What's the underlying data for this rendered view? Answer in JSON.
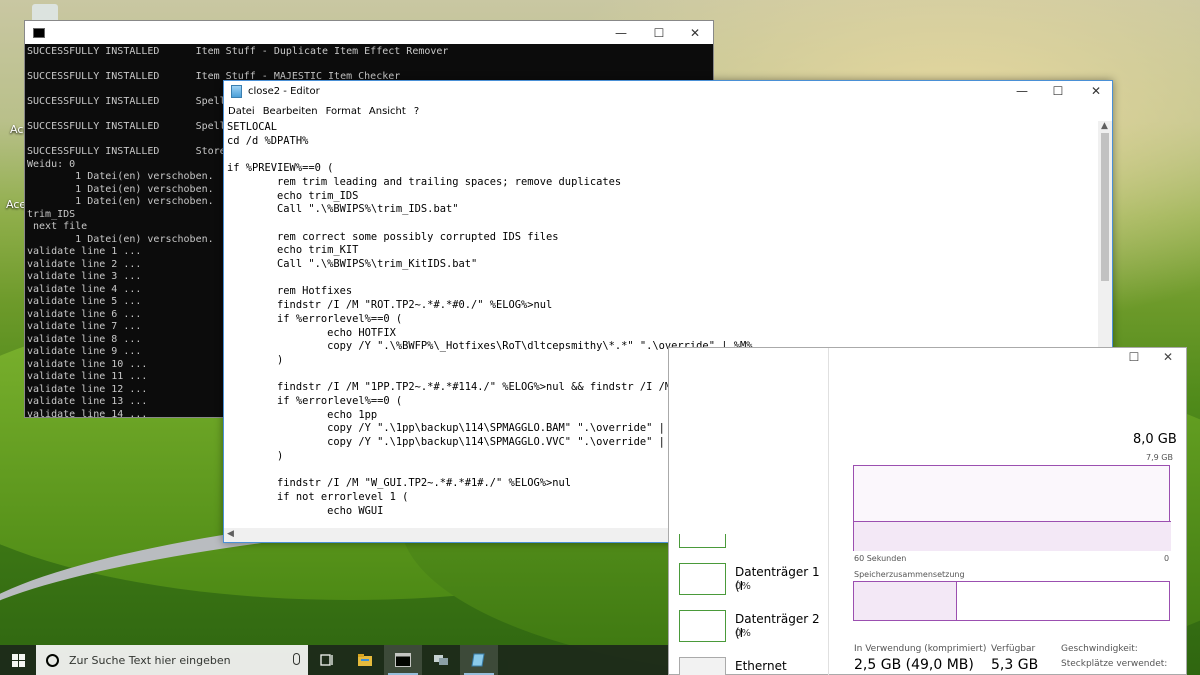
{
  "desktop": {
    "labels": [
      "Ace",
      "Ace"
    ]
  },
  "cmd": {
    "lines": [
      "SUCCESSFULLY INSTALLED      Item Stuff - Duplicate Item Effect Remover",
      "",
      "SUCCESSFULLY INSTALLED      Item Stuff - MAJESTIC Item Checker",
      "",
      "SUCCESSFULLY INSTALLED      Spell S",
      "",
      "SUCCESSFULLY INSTALLED      Spell S",
      "",
      "SUCCESSFULLY INSTALLED      Store S",
      "Weidu: 0",
      "        1 Datei(en) verschoben.",
      "        1 Datei(en) verschoben.",
      "        1 Datei(en) verschoben.",
      "trim_IDS",
      " next file",
      "        1 Datei(en) verschoben.",
      "validate line 1 ...",
      "validate line 2 ...",
      "validate line 3 ...",
      "validate line 4 ...",
      "validate line 5 ...",
      "validate line 6 ...",
      "validate line 7 ...",
      "validate line 8 ...",
      "validate line 9 ...",
      "validate line 10 ...",
      "validate line 11 ...",
      "validate line 12 ...",
      "validate line 13 ...",
      "validate line 14 ..."
    ],
    "buttons": {
      "minimize": "—",
      "maximize": "☐",
      "close": "✕"
    }
  },
  "notepad": {
    "title": "close2 - Editor",
    "menu": [
      "Datei",
      "Bearbeiten",
      "Format",
      "Ansicht",
      "?"
    ],
    "buttons": {
      "minimize": "—",
      "maximize": "☐",
      "close": "✕"
    },
    "content": "SETLOCAL\ncd /d %DPATH%\n\nif %PREVIEW%==0 (\n        rem trim leading and trailing spaces; remove duplicates\n        echo trim_IDS\n        Call \".\\%BWIPS%\\trim_IDS.bat\"\n\n        rem correct some possibly corrupted IDS files\n        echo trim_KIT\n        Call \".\\%BWIPS%\\trim_KitIDS.bat\"\n\n        rem Hotfixes\n        findstr /I /M \"ROT.TP2~.*#.*#0./\" %ELOG%>nul\n        if %errorlevel%==0 (\n                echo HOTFIX\n                copy /Y \".\\%BWFP%\\_Hotfixes\\RoT\\dltcepsmithy\\*.*\" \".\\override\" | %M%\n        )\n\n        findstr /I /M \"1PP.TP2~.*#.*#114./\" %ELOG%>nul && findstr /I /M \"SPELLPACKB6.TP2~.*#.*#1116./\" %ELOG%>nul\n        if %errorlevel%==0 (\n                echo 1pp\n                copy /Y \".\\1pp\\backup\\114\\SPMAGGLO.BAM\" \".\\override\" | %M%\n                copy /Y \".\\1pp\\backup\\114\\SPMAGGLO.VVC\" \".\\override\" | %M%\n        )\n\n        findstr /I /M \"W_GUI.TP2~.*#.*#1#./\" %ELOG%>nul\n        if not errorlevel 1 (\n                echo WGUI"
  },
  "taskmgr": {
    "buttons": {
      "maximize": "☐",
      "close": "✕"
    },
    "total_memory": "8,0 GB",
    "graph_max": "7,9 GB",
    "seconds_label": "60 Sekunden",
    "zero_label": "0",
    "composition_label": "Speicherzusammensetzung",
    "left_items": [
      {
        "name": "Datenträger 1 (I",
        "value": "0%"
      },
      {
        "name": "Datenträger 2 (I",
        "value": "0%"
      },
      {
        "name": "Ethernet",
        "value": ""
      }
    ],
    "stats": {
      "in_use_label": "In Verwendung (komprimiert)",
      "in_use_value": "2,5 GB (49,0 MB)",
      "available_label": "Verfügbar",
      "available_value": "5,3 GB",
      "speed_label": "Geschwindigkeit:",
      "slots_label": "Steckplätze verwendet:"
    }
  },
  "taskbar": {
    "search_placeholder": "Zur Suche Text hier eingeben",
    "apps": [
      "task-view-icon",
      "file-explorer-icon",
      "command-prompt-icon",
      "network-icon",
      "notepad-icon"
    ]
  }
}
